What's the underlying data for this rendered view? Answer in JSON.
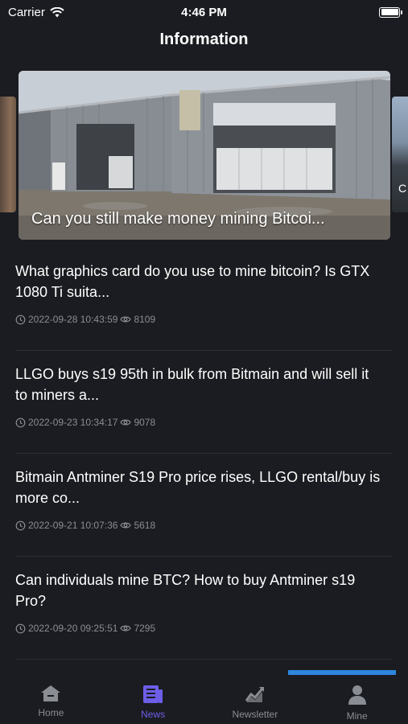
{
  "status_bar": {
    "carrier": "Carrier",
    "time": "4:46 PM"
  },
  "header": {
    "title": "Information"
  },
  "carousel": {
    "caption": "Can you still make money mining Bitcoi...",
    "peek_text": "C"
  },
  "news": [
    {
      "title": "What graphics card do you use to mine bitcoin? Is GTX 1080 Ti suita...",
      "date": "2022-09-28 10:43:59",
      "views": "8109"
    },
    {
      "title": "LLGO buys s19 95th in bulk from Bitmain and will sell it to miners a...",
      "date": "2022-09-23 10:34:17",
      "views": "9078"
    },
    {
      "title": "Bitmain Antminer S19 Pro price rises, LLGO rental/buy is more co...",
      "date": "2022-09-21 10:07:36",
      "views": "5618"
    },
    {
      "title": "Can individuals mine BTC? How to buy Antminer s19 Pro?",
      "date": "2022-09-20 09:25:51",
      "views": "7295"
    }
  ],
  "tabs": [
    {
      "label": "Home",
      "icon": "home-icon"
    },
    {
      "label": "News",
      "icon": "news-icon",
      "active": true
    },
    {
      "label": "Newsletter",
      "icon": "chart-icon"
    },
    {
      "label": "Mine",
      "icon": "person-icon"
    }
  ],
  "colors": {
    "background": "#1b1c21",
    "accent": "#6d5ee8",
    "muted": "#8b8d94",
    "progress": "#2e86de"
  }
}
